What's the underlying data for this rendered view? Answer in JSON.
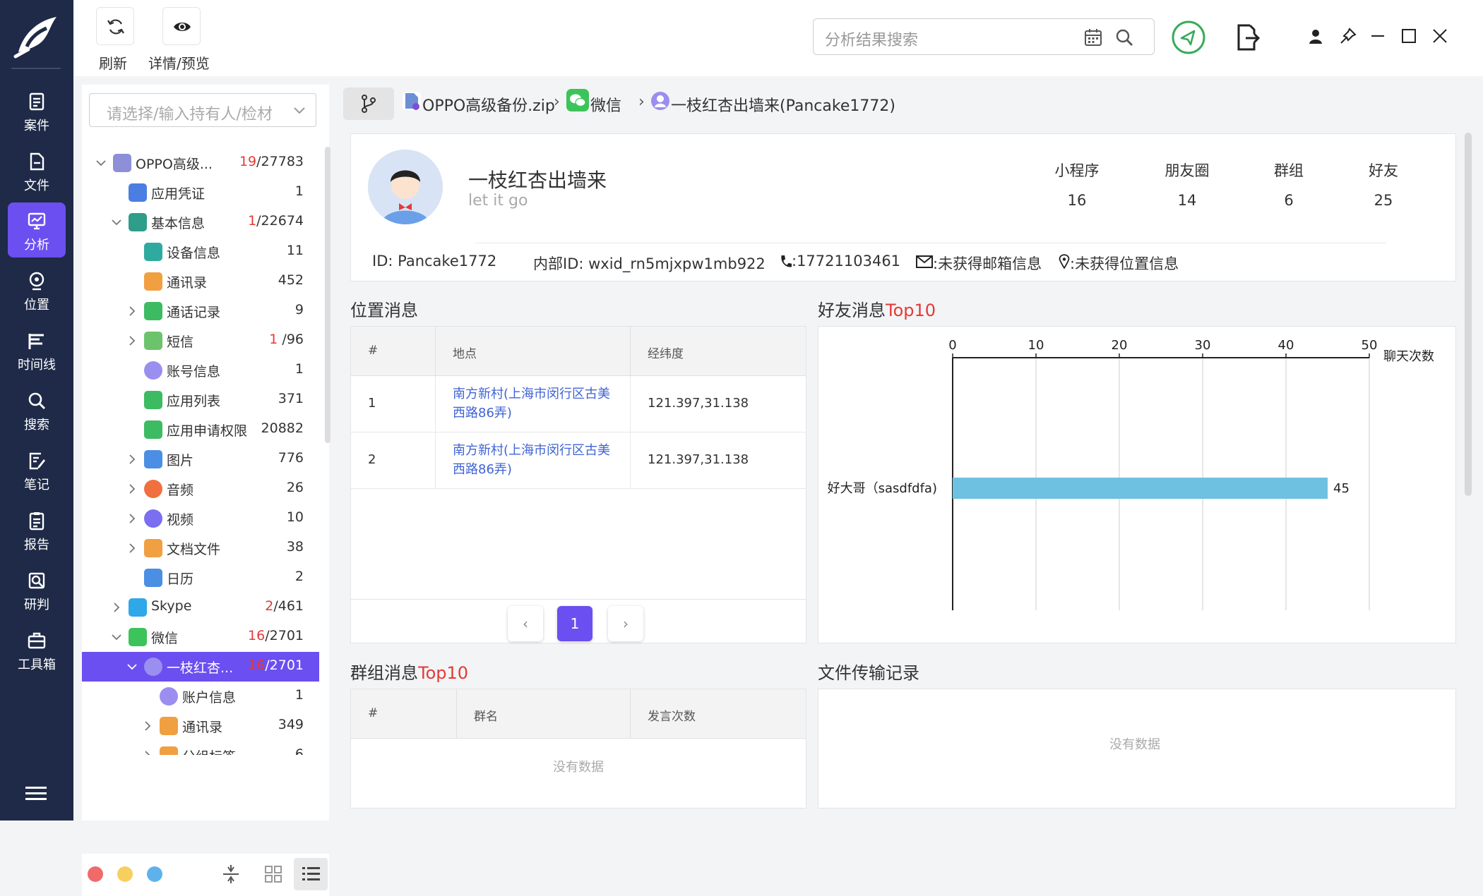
{
  "nav": {
    "items": [
      {
        "label": "案件",
        "icon": "case-icon"
      },
      {
        "label": "文件",
        "icon": "file-icon"
      },
      {
        "label": "分析",
        "icon": "analysis-icon",
        "active": true
      },
      {
        "label": "位置",
        "icon": "location-icon"
      },
      {
        "label": "时间线",
        "icon": "timeline-icon"
      },
      {
        "label": "搜索",
        "icon": "search-icon"
      },
      {
        "label": "笔记",
        "icon": "note-icon"
      },
      {
        "label": "报告",
        "icon": "report-icon"
      },
      {
        "label": "研判",
        "icon": "judge-icon"
      },
      {
        "label": "工具箱",
        "icon": "toolbox-icon"
      }
    ]
  },
  "toolbar": {
    "refresh_label": "刷新",
    "preview_label": "详情/预览",
    "search_placeholder": "分析结果搜索"
  },
  "left": {
    "select_placeholder": "请选择/输入持有人/检材",
    "tree": [
      {
        "name": "OPPO高级...",
        "red": "19",
        "count": "/27783"
      },
      {
        "name": "应用凭证",
        "count": "1"
      },
      {
        "name": "基本信息",
        "red": "1",
        "count": "/22674"
      },
      {
        "name": "设备信息",
        "count": "11"
      },
      {
        "name": "通讯录",
        "count": "452"
      },
      {
        "name": "通话记录",
        "count": "9"
      },
      {
        "name": "短信",
        "red": "1",
        "count": " /96"
      },
      {
        "name": "账号信息",
        "count": "1"
      },
      {
        "name": "应用列表",
        "count": "371"
      },
      {
        "name": "应用申请权限",
        "count": "20882"
      },
      {
        "name": "图片",
        "count": "776"
      },
      {
        "name": "音频",
        "count": "26"
      },
      {
        "name": "视频",
        "count": "10"
      },
      {
        "name": "文档文件",
        "count": "38"
      },
      {
        "name": "日历",
        "count": "2"
      },
      {
        "name": "Skype",
        "red": "2",
        "count": "/461"
      },
      {
        "name": "微信",
        "red": "16",
        "count": "/2701"
      },
      {
        "name": "一枝红杏...",
        "red": "16",
        "count": "/2701"
      },
      {
        "name": "账户信息",
        "count": "1"
      },
      {
        "name": "通讯录",
        "count": "349"
      },
      {
        "name": "分组标签",
        "count": "6"
      }
    ]
  },
  "breadcrumb": {
    "item1": "OPPO高级备份.zip",
    "item2": "微信",
    "item3": "一枝红杏出墙来(Pancake1772)"
  },
  "profile": {
    "name": "一枝红杏出墙来",
    "signature": "let it go",
    "stats": [
      {
        "label": "小程序",
        "value": "16"
      },
      {
        "label": "朋友圈",
        "value": "14"
      },
      {
        "label": "群组",
        "value": "6"
      },
      {
        "label": "好友",
        "value": "25"
      }
    ],
    "id": "ID: Pancake1772",
    "internal_id": "内部ID: wxid_rn5mjxpw1mb922",
    "phone": ":17721103461",
    "email": ":未获得邮箱信息",
    "location": ":未获得位置信息"
  },
  "location_section": {
    "title": "位置消息",
    "headers": [
      "#",
      "地点",
      "经纬度"
    ],
    "rows": [
      {
        "num": "1",
        "place": "南方新村(上海市闵行区古美西路86弄)",
        "coords": "121.397,31.138"
      },
      {
        "num": "2",
        "place": "南方新村(上海市闵行区古美西路86弄)",
        "coords": "121.397,31.138"
      }
    ],
    "page": "1"
  },
  "friends_section": {
    "title_prefix": "好友消息",
    "title_hl": "Top10"
  },
  "chart_data": {
    "type": "bar",
    "orientation": "horizontal",
    "categories": [
      "好大哥（sasdfdfa)"
    ],
    "values": [
      45
    ],
    "xlabel": "聊天次数",
    "xlim": [
      0,
      50
    ],
    "xticks": [
      0,
      10,
      20,
      30,
      40,
      50
    ],
    "bar_color": "#6ec1e0",
    "grid": true,
    "axis_position": "top"
  },
  "group_section": {
    "title_prefix": "群组消息",
    "title_hl": "Top10",
    "headers": [
      "#",
      "群名",
      "发言次数"
    ],
    "empty": "没有数据"
  },
  "file_section": {
    "title": "文件传输记录",
    "empty": "没有数据"
  },
  "colors": {
    "accent": "#6b4ff0",
    "nav_bg": "#1e2a47",
    "highlight_red": "#e53935",
    "link": "#3f63d4"
  }
}
